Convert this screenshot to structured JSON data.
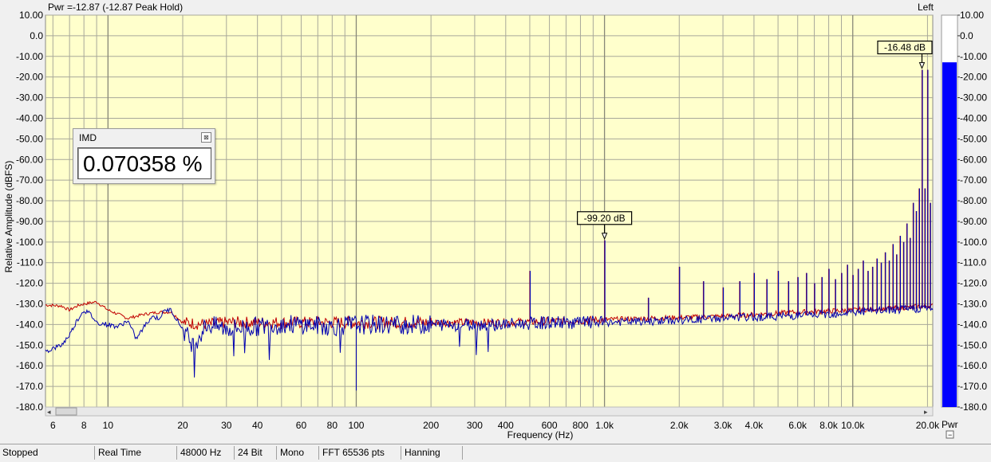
{
  "chart_data": {
    "type": "line",
    "title": "Pwr =-12.87 (-12.87 Peak Hold)",
    "channel": "Left",
    "xlabel": "Frequency (Hz)",
    "ylabel": "Relative Amplitude (dBFS)",
    "x_scale": "log",
    "xlim": [
      5.6,
      21000
    ],
    "ylim": [
      -180,
      10
    ],
    "y_ticks": [
      "10.00",
      "0.0",
      "-10.00",
      "-20.00",
      "-30.00",
      "-40.00",
      "-50.00",
      "-60.00",
      "-70.00",
      "-80.00",
      "-90.00",
      "-100.0",
      "-110.0",
      "-120.0",
      "-130.0",
      "-140.0",
      "-150.0",
      "-160.0",
      "-170.0",
      "-180.0"
    ],
    "x_ticks": [
      {
        "v": 6,
        "label": "6"
      },
      {
        "v": 8,
        "label": "8"
      },
      {
        "v": 10,
        "label": "10"
      },
      {
        "v": 20,
        "label": "20"
      },
      {
        "v": 30,
        "label": "30"
      },
      {
        "v": 40,
        "label": "40"
      },
      {
        "v": 60,
        "label": "60"
      },
      {
        "v": 80,
        "label": "80"
      },
      {
        "v": 100,
        "label": "100"
      },
      {
        "v": 200,
        "label": "200"
      },
      {
        "v": 300,
        "label": "300"
      },
      {
        "v": 400,
        "label": "400"
      },
      {
        "v": 600,
        "label": "600"
      },
      {
        "v": 800,
        "label": "800"
      },
      {
        "v": 1000,
        "label": "1.0k"
      },
      {
        "v": 2000,
        "label": "2.0k"
      },
      {
        "v": 3000,
        "label": "3.0k"
      },
      {
        "v": 4000,
        "label": "4.0k"
      },
      {
        "v": 6000,
        "label": "6.0k"
      },
      {
        "v": 8000,
        "label": "8.0k"
      },
      {
        "v": 10000,
        "label": "10.0k"
      },
      {
        "v": 20000,
        "label": "20.0k"
      }
    ],
    "grid": true,
    "series": [
      {
        "color": "#c00000",
        "points": [
          [
            5.6,
            -130.5
          ],
          [
            6.5,
            -131
          ],
          [
            7,
            -133
          ],
          [
            7.5,
            -131
          ],
          [
            8,
            -130
          ],
          [
            9,
            -129
          ],
          [
            10,
            -133
          ],
          [
            11,
            -135
          ],
          [
            12,
            -137
          ],
          [
            14,
            -135
          ],
          [
            16,
            -134
          ],
          [
            18,
            -134
          ],
          [
            20,
            -139
          ],
          [
            25,
            -140
          ],
          [
            30,
            -139
          ],
          [
            40,
            -139
          ],
          [
            60,
            -139
          ],
          [
            100,
            -139
          ],
          [
            200,
            -139
          ],
          [
            400,
            -139
          ],
          [
            800,
            -138
          ],
          [
            1500,
            -137
          ],
          [
            3000,
            -136
          ],
          [
            6000,
            -134
          ],
          [
            10000,
            -133
          ],
          [
            15000,
            -132
          ],
          [
            20000,
            -131
          ],
          [
            21000,
            -131
          ]
        ]
      },
      {
        "color": "#0000b0",
        "points": [
          [
            5.6,
            -153
          ],
          [
            6.5,
            -150
          ],
          [
            7,
            -145
          ],
          [
            7.5,
            -138
          ],
          [
            8,
            -133
          ],
          [
            8.5,
            -135
          ],
          [
            9,
            -139
          ],
          [
            10,
            -140
          ],
          [
            11,
            -141
          ],
          [
            12,
            -138
          ],
          [
            13,
            -147
          ],
          [
            14,
            -141
          ],
          [
            15,
            -136
          ],
          [
            16,
            -137
          ],
          [
            17,
            -133
          ],
          [
            18,
            -133
          ],
          [
            19,
            -138
          ],
          [
            20,
            -142
          ],
          [
            22,
            -150
          ],
          [
            25,
            -140
          ],
          [
            30,
            -142
          ],
          [
            40,
            -141
          ],
          [
            50,
            -140
          ],
          [
            60,
            -140
          ],
          [
            80,
            -141
          ],
          [
            100,
            -140
          ],
          [
            150,
            -140
          ],
          [
            200,
            -140
          ],
          [
            300,
            -140
          ],
          [
            400,
            -140
          ],
          [
            600,
            -139
          ],
          [
            1000,
            -139
          ],
          [
            2000,
            -138
          ],
          [
            3000,
            -137
          ],
          [
            5000,
            -136
          ],
          [
            8000,
            -135
          ],
          [
            10000,
            -134
          ],
          [
            15000,
            -133
          ],
          [
            20000,
            -132
          ],
          [
            21000,
            -132
          ]
        ]
      }
    ],
    "spikes": [
      {
        "f": 500,
        "db": -114
      },
      {
        "f": 1000,
        "db": -99.2
      },
      {
        "f": 1500,
        "db": -127
      },
      {
        "f": 2000,
        "db": -112
      },
      {
        "f": 2500,
        "db": -119
      },
      {
        "f": 3000,
        "db": -122
      },
      {
        "f": 3500,
        "db": -119
      },
      {
        "f": 4000,
        "db": -115
      },
      {
        "f": 4500,
        "db": -118
      },
      {
        "f": 5000,
        "db": -114
      },
      {
        "f": 5500,
        "db": -119
      },
      {
        "f": 6000,
        "db": -117
      },
      {
        "f": 6500,
        "db": -115
      },
      {
        "f": 7000,
        "db": -120
      },
      {
        "f": 7500,
        "db": -117
      },
      {
        "f": 8000,
        "db": -113
      },
      {
        "f": 8500,
        "db": -118
      },
      {
        "f": 9000,
        "db": -115
      },
      {
        "f": 9500,
        "db": -111
      },
      {
        "f": 10000,
        "db": -116
      },
      {
        "f": 10500,
        "db": -113
      },
      {
        "f": 11000,
        "db": -109
      },
      {
        "f": 11500,
        "db": -114
      },
      {
        "f": 12000,
        "db": -112
      },
      {
        "f": 12500,
        "db": -108
      },
      {
        "f": 13000,
        "db": -110
      },
      {
        "f": 13500,
        "db": -105
      },
      {
        "f": 14000,
        "db": -109
      },
      {
        "f": 14500,
        "db": -101
      },
      {
        "f": 15000,
        "db": -106
      },
      {
        "f": 15500,
        "db": -97
      },
      {
        "f": 16000,
        "db": -100
      },
      {
        "f": 16500,
        "db": -91
      },
      {
        "f": 17000,
        "db": -98
      },
      {
        "f": 17500,
        "db": -81
      },
      {
        "f": 18000,
        "db": -85
      },
      {
        "f": 18500,
        "db": -74
      },
      {
        "f": 19000,
        "db": -16.48
      },
      {
        "f": 19500,
        "db": -74
      },
      {
        "f": 20000,
        "db": -16.5
      },
      {
        "f": 20500,
        "db": -81
      }
    ],
    "markers": [
      {
        "f": 1000,
        "db": -99.2,
        "label": "-99.20 dB"
      },
      {
        "f": 19000,
        "db": -16.48,
        "label": "-16.48 dB"
      }
    ],
    "meter": {
      "label": "Pwr",
      "value_db": -12.87,
      "bar_color": "#0000ff",
      "y_ticks": [
        "10.00",
        "0.0",
        "-10.00",
        "-20.00",
        "-30.00",
        "-40.00",
        "-50.00",
        "-60.00",
        "-70.00",
        "-80.00",
        "-90.00",
        "-100.0",
        "-110.0",
        "-120.0",
        "-130.0",
        "-140.0",
        "-150.0",
        "-160.0",
        "-170.0",
        "-180.0"
      ]
    },
    "plot_bg": "#ffffcc"
  },
  "imd_panel": {
    "title": "IMD",
    "value": "0.070358 %",
    "close_symbol": "⊠"
  },
  "status_bar": [
    "Stopped",
    "Real Time",
    "48000 Hz",
    "24 Bit",
    "Mono",
    "FFT 65536 pts",
    "Hanning"
  ]
}
